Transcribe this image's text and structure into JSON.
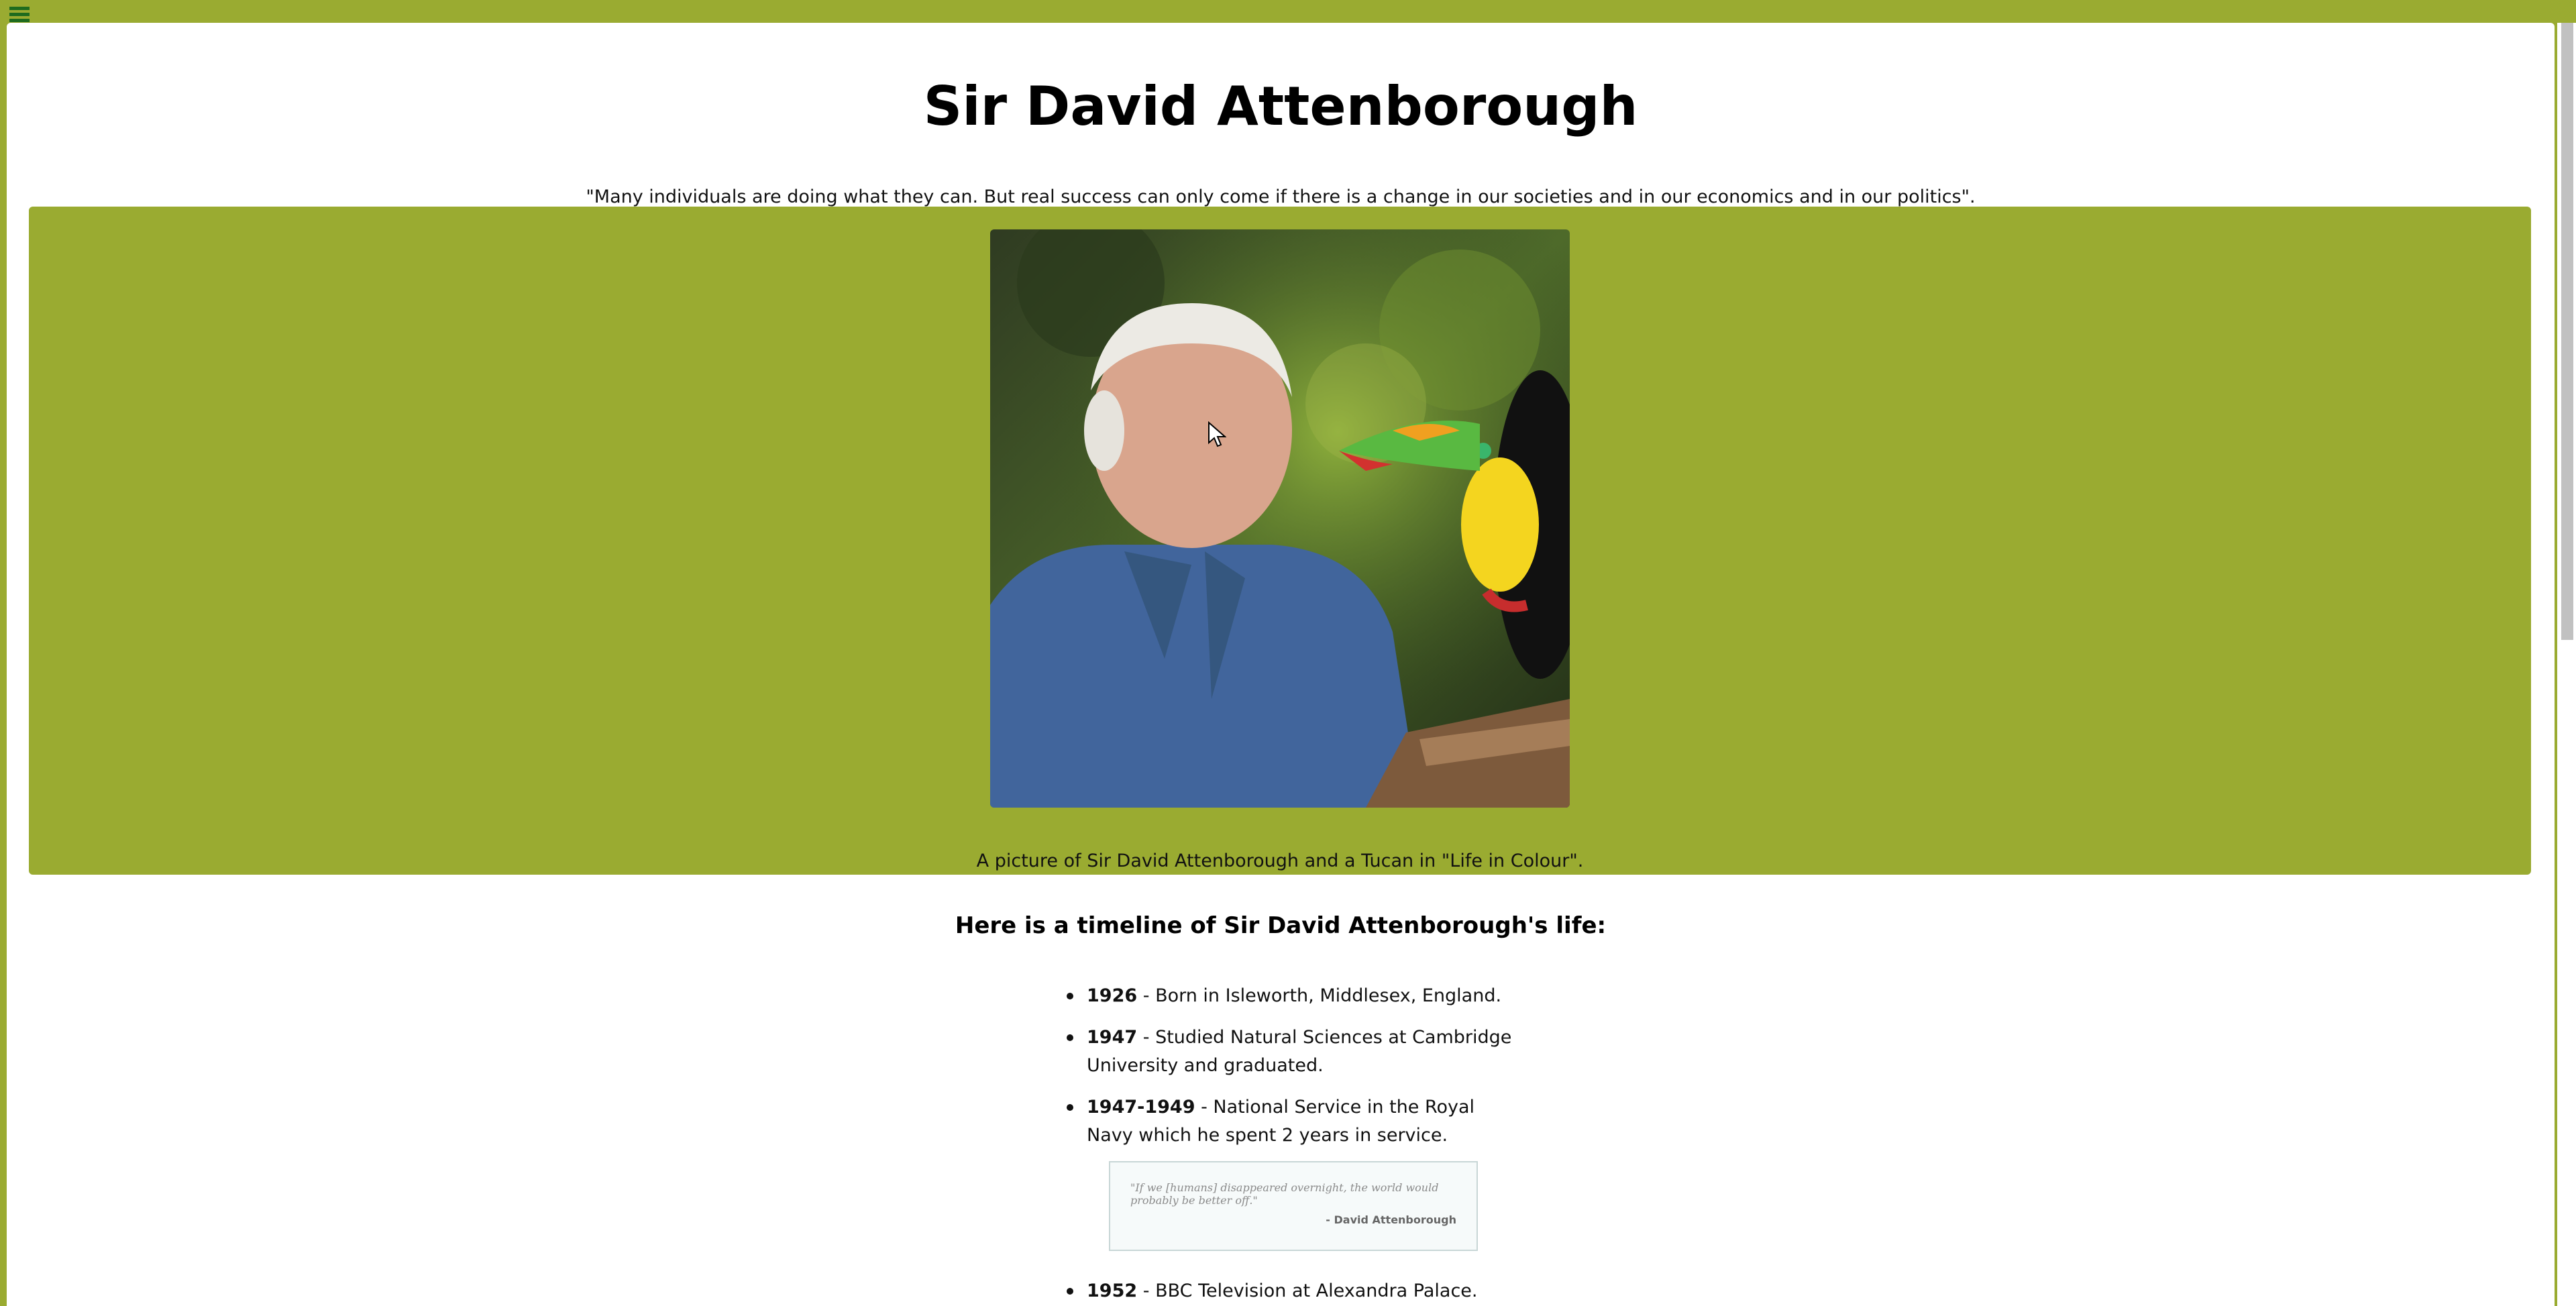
{
  "colors": {
    "accent": "#9aab31",
    "menu_icon": "#1e6b1e"
  },
  "header": {
    "title": "Sir David Attenborough",
    "quote": "\"Many individuals are doing what they can. But real success can only come if there is a change in our societies and in our economics and in our politics\"."
  },
  "hero": {
    "image_alt": "Sir David Attenborough with a toucan",
    "caption": "A picture of Sir David Attenborough and a Tucan in \"Life in Colour\"."
  },
  "timeline": {
    "heading": "Here is a timeline of Sir David Attenborough's life:",
    "items": [
      {
        "year": "1926",
        "text": " - Born in Isleworth, Middlesex, England."
      },
      {
        "year": "1947",
        "text": " - Studied Natural Sciences at Cambridge University and graduated."
      },
      {
        "year": "1947-1949",
        "text": " - National Service in the Royal Navy which he spent 2 years in service."
      },
      {
        "year": "1952",
        "text": " - BBC Television at Alexandra Palace."
      }
    ]
  },
  "blockquote": {
    "text": "\"If we [humans] disappeared overnight, the world would probably be better off.\"",
    "author": "- David Attenborough"
  }
}
